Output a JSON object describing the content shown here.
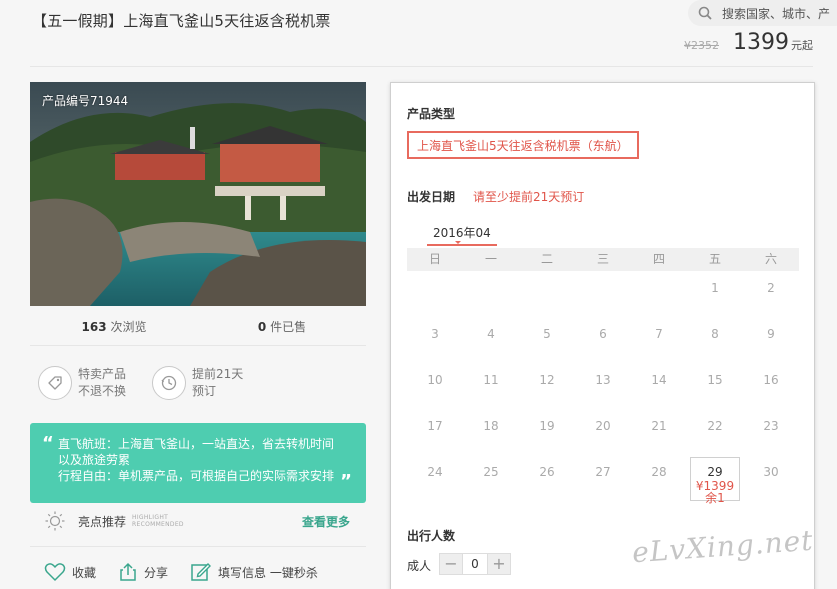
{
  "header": {
    "title": "【五一假期】上海直飞釜山5天往返含税机票",
    "search_placeholder": "搜索国家、城市、产",
    "original_price": "¥2352",
    "price": "1399",
    "price_suffix": "元起"
  },
  "gallery": {
    "product_id": "产品编号71944"
  },
  "stats": {
    "views": "163",
    "views_label": "次浏览",
    "sold": "0",
    "sold_label": "件已售"
  },
  "features": [
    {
      "icon": "tag-icon",
      "line1": "特卖产品",
      "line2": "不退不换"
    },
    {
      "icon": "clock-icon",
      "line1": "提前21天",
      "line2": "预订"
    }
  ],
  "highlights": {
    "quote_open": "“",
    "quote_close": "”",
    "lines": [
      "直飞航班：上海直飞釜山，一站直达，省去转机时间",
      "以及旅途劳累",
      "行程自由：单机票产品，可根据自己的实际需求安排"
    ]
  },
  "recommend": {
    "label": "亮点推荐",
    "en": "HIGHLIGHT RECOMMENDED",
    "see_more": "查看更多"
  },
  "actions": {
    "favorite": "收藏",
    "share": "分享",
    "fill_info": "填写信息 一键秒杀"
  },
  "booking": {
    "product_type_label": "产品类型",
    "product_type_option": "上海直飞釜山5天往返含税机票（东航）",
    "departure_label": "出发日期",
    "departure_hint": "请至少提前21天预订",
    "month": "2016年04",
    "weekdays": [
      "日",
      "一",
      "二",
      "三",
      "四",
      "五",
      "六"
    ],
    "weeks": [
      [
        "",
        "",
        "",
        "",
        "",
        "1",
        "2"
      ],
      [
        "3",
        "4",
        "5",
        "6",
        "7",
        "8",
        "9"
      ],
      [
        "10",
        "11",
        "12",
        "13",
        "14",
        "15",
        "16"
      ],
      [
        "17",
        "18",
        "19",
        "20",
        "21",
        "22",
        "23"
      ],
      [
        "24",
        "25",
        "26",
        "27",
        "28",
        "29",
        "30"
      ]
    ],
    "selected_day": {
      "day": "29",
      "price": "¥1399",
      "stock": "余1"
    },
    "travelers_label": "出行人数",
    "adult_label": "成人",
    "adult_count": "0",
    "minus": "−",
    "plus": "+"
  },
  "watermark": "eLvXing.net",
  "colors": {
    "accent_red": "#e0554a",
    "highlight_green": "#4ecdb0",
    "link_green": "#3aa68d"
  }
}
